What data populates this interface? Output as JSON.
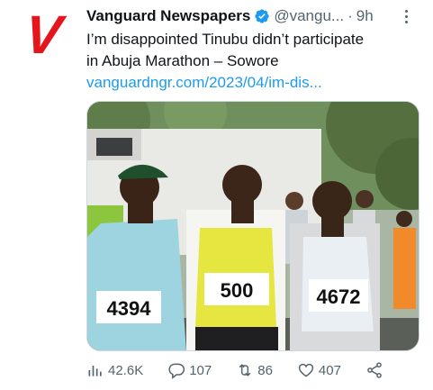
{
  "account": {
    "avatar_letter": "V",
    "display_name": "Vanguard Newspapers",
    "handle": "@vangu...",
    "separator": "·",
    "time": "9h"
  },
  "tweet": {
    "text_line1": "I’m disappointed Tinubu didn’t participate",
    "text_line2": "in Abuja Marathon – Sowore",
    "link": "vanguardngr.com/2023/04/im-dis..."
  },
  "media": {
    "bib_left": "4394",
    "bib_center": "500",
    "bib_right": "4672"
  },
  "actions": {
    "views": "42.6K",
    "replies": "107",
    "retweets": "86",
    "likes": "407"
  },
  "colors": {
    "brand_red": "#e4161b",
    "link_blue": "#1d9bf0",
    "secondary_text": "#536471",
    "verified": "#1d9bf0"
  },
  "icons": [
    "verified-badge",
    "more-icon",
    "views-icon",
    "reply-icon",
    "retweet-icon",
    "like-icon",
    "share-icon"
  ]
}
